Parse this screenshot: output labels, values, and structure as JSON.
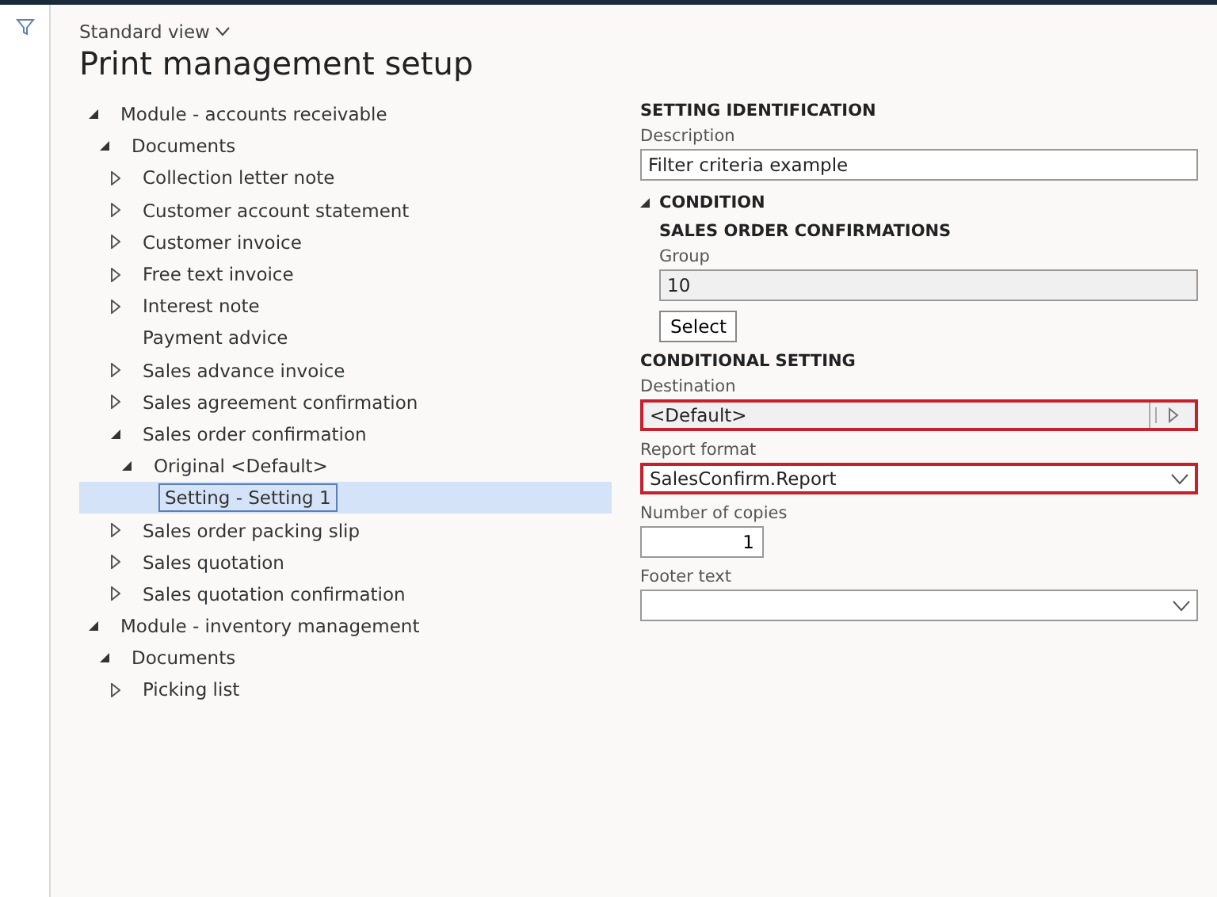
{
  "view_selector": "Standard view",
  "title": "Print management setup",
  "tree": [
    {
      "label": "Module - accounts receivable",
      "expanded": true,
      "selected": false,
      "children": [
        {
          "label": "Documents",
          "expanded": true,
          "selected": false,
          "children": [
            {
              "label": "Collection letter note",
              "expanded": false,
              "selected": false
            },
            {
              "label": "Customer account statement",
              "expanded": false,
              "selected": false
            },
            {
              "label": "Customer invoice",
              "expanded": false,
              "selected": false
            },
            {
              "label": "Free text invoice",
              "expanded": false,
              "selected": false
            },
            {
              "label": "Interest note",
              "expanded": false,
              "selected": false
            },
            {
              "label": "Payment advice",
              "selected": false
            },
            {
              "label": "Sales advance invoice",
              "expanded": false,
              "selected": false
            },
            {
              "label": "Sales agreement confirmation",
              "expanded": false,
              "selected": false
            },
            {
              "label": "Sales order confirmation",
              "expanded": true,
              "selected": false,
              "children": [
                {
                  "label": "Original <Default>",
                  "expanded": true,
                  "selected": false,
                  "children": [
                    {
                      "label": "Setting - Setting 1",
                      "selected": true
                    }
                  ]
                }
              ]
            },
            {
              "label": "Sales order packing slip",
              "expanded": false,
              "selected": false
            },
            {
              "label": "Sales quotation",
              "expanded": false,
              "selected": false
            },
            {
              "label": "Sales quotation confirmation",
              "expanded": false,
              "selected": false
            }
          ]
        }
      ]
    },
    {
      "label": "Module - inventory management",
      "expanded": true,
      "selected": false,
      "children": [
        {
          "label": "Documents",
          "expanded": true,
          "selected": false,
          "children": [
            {
              "label": "Picking list",
              "expanded": false,
              "selected": false
            }
          ]
        }
      ]
    }
  ],
  "setting_identification": {
    "heading": "SETTING IDENTIFICATION",
    "description": {
      "label": "Description",
      "value": "Filter criteria example"
    }
  },
  "condition": {
    "heading": "CONDITION",
    "expanded": true,
    "subheading": "SALES ORDER CONFIRMATIONS",
    "group": {
      "label": "Group",
      "value": "10"
    },
    "select_button": "Select"
  },
  "conditional_setting": {
    "heading": "CONDITIONAL SETTING",
    "fields": [
      {
        "kind": "lookup",
        "label": "Destination",
        "value": "<Default>",
        "highlighted": true
      },
      {
        "kind": "select",
        "label": "Report format",
        "value": "SalesConfirm.Report",
        "highlighted": true
      },
      {
        "kind": "number",
        "label": "Number of copies",
        "value": "1",
        "highlighted": false
      },
      {
        "kind": "select",
        "label": "Footer text",
        "highlighted": false
      }
    ]
  }
}
